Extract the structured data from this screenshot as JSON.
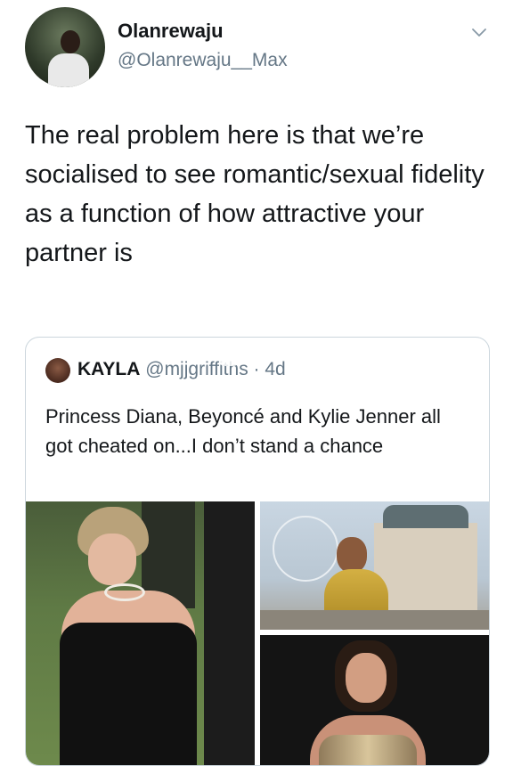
{
  "tweet": {
    "author": {
      "display_name": "Olanrewaju",
      "handle": "@Olanrewaju__Max",
      "avatar_icon": "profile-photo"
    },
    "more_icon": "chevron-down-icon",
    "text": "The real problem here is that we’re socialised to see romantic/sexual fidelity as a function of how attractive your partner is"
  },
  "quoted_tweet": {
    "author": {
      "display_name": "KAYLA",
      "handle": "@mjjgriffiths",
      "time": "· 4d"
    },
    "text": "Princess Diana, Beyoncé and Kylie Jenner all got cheated on...I don’t stand a chance",
    "media": [
      {
        "name": "photo-princess-diana"
      },
      {
        "name": "photo-beyonce"
      },
      {
        "name": "photo-kylie-jenner"
      }
    ]
  },
  "colors": {
    "text_primary": "#14171a",
    "text_secondary": "#657786",
    "border": "#ccd6dd"
  }
}
